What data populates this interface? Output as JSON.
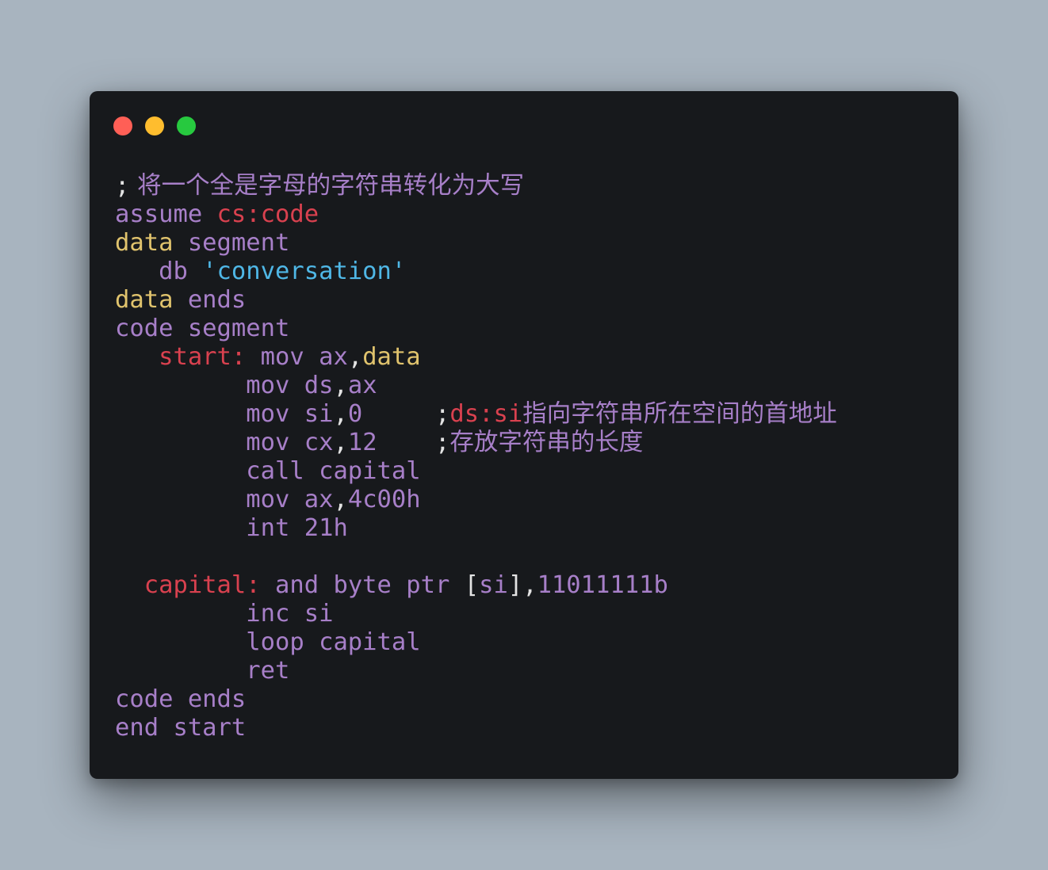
{
  "window": {
    "traffic_lights": [
      {
        "name": "close-dot",
        "color": "#ff5f56"
      },
      {
        "name": "minimize-dot",
        "color": "#ffbd2e"
      },
      {
        "name": "maximize-dot",
        "color": "#27c93f"
      }
    ]
  },
  "colors": {
    "background": "#a8b4bf",
    "window": "#17191c",
    "default": "#a77fc8",
    "keyword": "#e0c36d",
    "label": "#d9414f",
    "string": "#4fb7e6",
    "punct": "#e3e3e3"
  },
  "code_lines": [
    [
      {
        "t": ";",
        "c": "punct"
      },
      {
        "t": " 将一个全是字母的字符串转化为大写",
        "c": "default",
        "cjk": true
      }
    ],
    [
      {
        "t": "assume ",
        "c": "default"
      },
      {
        "t": "cs:code",
        "c": "label"
      }
    ],
    [
      {
        "t": "data",
        "c": "keyword"
      },
      {
        "t": " segment",
        "c": "default"
      }
    ],
    [
      {
        "t": "   db ",
        "c": "default"
      },
      {
        "t": "'conversation'",
        "c": "string"
      }
    ],
    [
      {
        "t": "data",
        "c": "keyword"
      },
      {
        "t": " ends",
        "c": "default"
      }
    ],
    [
      {
        "t": "code segment",
        "c": "default"
      }
    ],
    [
      {
        "t": "   start:",
        "c": "label"
      },
      {
        "t": " mov ax",
        "c": "default"
      },
      {
        "t": ",",
        "c": "punct"
      },
      {
        "t": "data",
        "c": "keyword"
      }
    ],
    [
      {
        "t": "         mov ds",
        "c": "default"
      },
      {
        "t": ",",
        "c": "punct"
      },
      {
        "t": "ax",
        "c": "default"
      }
    ],
    [
      {
        "t": "         mov si",
        "c": "default"
      },
      {
        "t": ",",
        "c": "punct"
      },
      {
        "t": "0     ",
        "c": "default"
      },
      {
        "t": ";",
        "c": "punct"
      },
      {
        "t": "ds:si",
        "c": "label"
      },
      {
        "t": "指向字符串所在空间的首地址",
        "c": "default",
        "cjk": true
      }
    ],
    [
      {
        "t": "         mov cx",
        "c": "default"
      },
      {
        "t": ",",
        "c": "punct"
      },
      {
        "t": "12    ",
        "c": "default"
      },
      {
        "t": ";",
        "c": "punct"
      },
      {
        "t": "存放字符串的长度",
        "c": "default",
        "cjk": true
      }
    ],
    [
      {
        "t": "         call capital",
        "c": "default"
      }
    ],
    [
      {
        "t": "         mov ax",
        "c": "default"
      },
      {
        "t": ",",
        "c": "punct"
      },
      {
        "t": "4c00h",
        "c": "default"
      }
    ],
    [
      {
        "t": "         int 21h",
        "c": "default"
      }
    ],
    [],
    [
      {
        "t": "  capital:",
        "c": "label"
      },
      {
        "t": " and byte ptr ",
        "c": "default"
      },
      {
        "t": "[",
        "c": "punct"
      },
      {
        "t": "si",
        "c": "default"
      },
      {
        "t": "],",
        "c": "punct"
      },
      {
        "t": "11011111b",
        "c": "default"
      }
    ],
    [
      {
        "t": "         inc si",
        "c": "default"
      }
    ],
    [
      {
        "t": "         loop capital",
        "c": "default"
      }
    ],
    [
      {
        "t": "         ret",
        "c": "default"
      }
    ],
    [
      {
        "t": "code ends",
        "c": "default"
      }
    ],
    [
      {
        "t": "end start",
        "c": "default"
      }
    ]
  ]
}
